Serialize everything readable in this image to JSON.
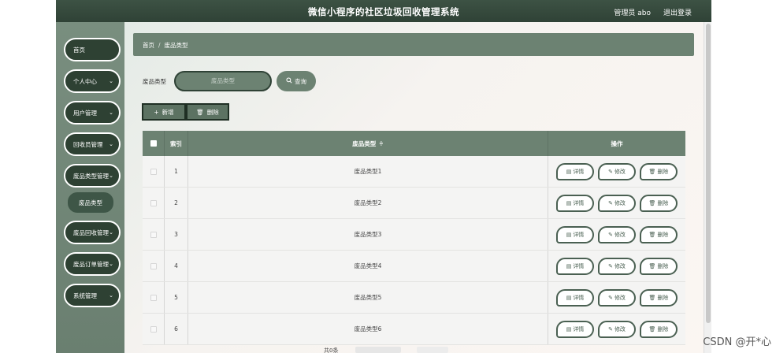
{
  "header": {
    "title": "微信小程序的社区垃圾回收管理系统",
    "user": "管理员 abo",
    "logout": "退出登录"
  },
  "sidebar": {
    "items": [
      {
        "label": "首页",
        "chevron": ""
      },
      {
        "label": "个人中心",
        "chevron": "⌄"
      },
      {
        "label": "用户管理",
        "chevron": "⌄"
      },
      {
        "label": "回收员管理",
        "chevron": "⌄"
      },
      {
        "label": "废品类型管理",
        "chevron": "⌄"
      },
      {
        "label": "废品回收管理",
        "chevron": "⌄"
      },
      {
        "label": "废品订单管理",
        "chevron": "⌄"
      },
      {
        "label": "系统管理",
        "chevron": "⌄"
      }
    ],
    "active_sub": "废品类型"
  },
  "breadcrumb": {
    "home": "首页",
    "sep": "/",
    "current": "废品类型"
  },
  "search": {
    "label": "废品类型",
    "placeholder": "废品类型",
    "button": "查询",
    "icon": "search-icon"
  },
  "actions": {
    "add": "新增",
    "add_icon": "+",
    "delete": "删除",
    "delete_icon": "🗑"
  },
  "table": {
    "headers": {
      "index": "索引",
      "type": "废品类型",
      "type_sort": "≑",
      "ops": "操作"
    },
    "rows": [
      {
        "index": "1",
        "type": "废品类型1"
      },
      {
        "index": "2",
        "type": "废品类型2"
      },
      {
        "index": "3",
        "type": "废品类型3"
      },
      {
        "index": "4",
        "type": "废品类型4"
      },
      {
        "index": "5",
        "type": "废品类型5"
      },
      {
        "index": "6",
        "type": "废品类型6"
      }
    ],
    "row_ops": [
      {
        "label": "详情",
        "icon": "▤",
        "name": "detail"
      },
      {
        "label": "修改",
        "icon": "✎",
        "name": "edit"
      },
      {
        "label": "删除",
        "icon": "🗑",
        "name": "delete"
      }
    ]
  },
  "pager": {
    "label": "共0条"
  },
  "watermark": "CSDN @开*心",
  "colors": {
    "header": "#2f4236",
    "accent": "#6c8272",
    "nav": "#2e4133"
  }
}
